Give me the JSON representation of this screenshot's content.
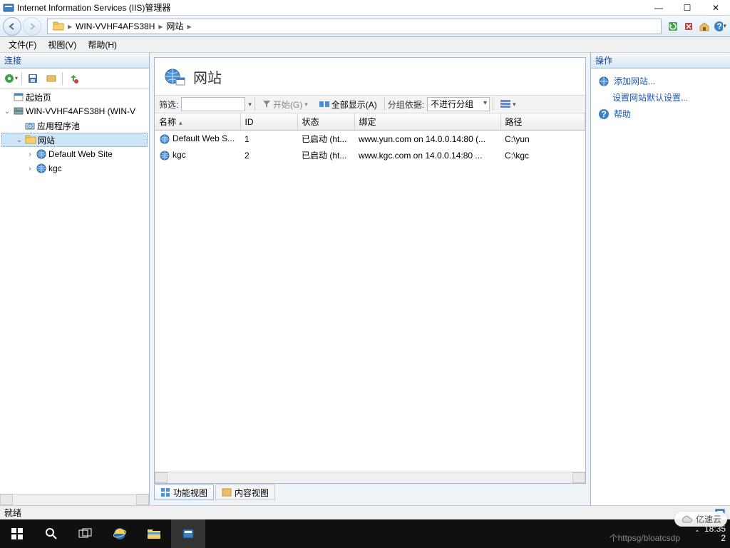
{
  "window": {
    "title": "Internet Information Services (IIS)管理器",
    "controls": {
      "min": "—",
      "max": "☐",
      "close": "✕"
    }
  },
  "nav": {
    "crumbs": [
      "WIN-VVHF4AFS38H",
      "网站"
    ],
    "tools": {
      "refresh": "refresh",
      "stop": "stop",
      "home": "home",
      "help": "help"
    }
  },
  "menu": {
    "file": "文件(F)",
    "view": "视图(V)",
    "help": "帮助(H)"
  },
  "connections": {
    "title": "连接",
    "tree": [
      {
        "level": 0,
        "toggle": "",
        "icon": "start-page",
        "label": "起始页"
      },
      {
        "level": 0,
        "toggle": "v",
        "icon": "server",
        "label": "WIN-VVHF4AFS38H (WIN-V"
      },
      {
        "level": 1,
        "toggle": "",
        "icon": "app-pool",
        "label": "应用程序池"
      },
      {
        "level": 1,
        "toggle": "v",
        "icon": "sites",
        "label": "网站",
        "selected": true
      },
      {
        "level": 2,
        "toggle": ">",
        "icon": "site",
        "label": "Default Web Site"
      },
      {
        "level": 2,
        "toggle": ">",
        "icon": "site",
        "label": "kgc"
      }
    ]
  },
  "content": {
    "heading": "网站",
    "filter_label": "筛选:",
    "start_label": "开始(G)",
    "showall_label": "全部显示(A)",
    "groupby_label": "分组依据:",
    "group_value": "不进行分组",
    "columns": [
      "名称",
      "ID",
      "状态",
      "绑定",
      "路径"
    ],
    "rows": [
      {
        "name": "Default Web S...",
        "id": "1",
        "status": "已启动 (ht...",
        "binding": "www.yun.com on 14.0.0.14:80 (...",
        "path": "C:\\yun"
      },
      {
        "name": "kgc",
        "id": "2",
        "status": "已启动 (ht...",
        "binding": "www.kgc.com on 14.0.0.14:80 ...",
        "path": "C:\\kgc"
      }
    ],
    "tabs": {
      "features": "功能视图",
      "content": "内容视图"
    }
  },
  "actions": {
    "title": "操作",
    "add_site": "添加网站...",
    "defaults": "设置网站默认设置...",
    "help": "帮助"
  },
  "status": {
    "ready": "就绪"
  },
  "taskbar": {
    "watermark": "个httpsg/bloatcsdp",
    "time": "18:35",
    "date": "2"
  },
  "cloud_badge": "亿速云"
}
